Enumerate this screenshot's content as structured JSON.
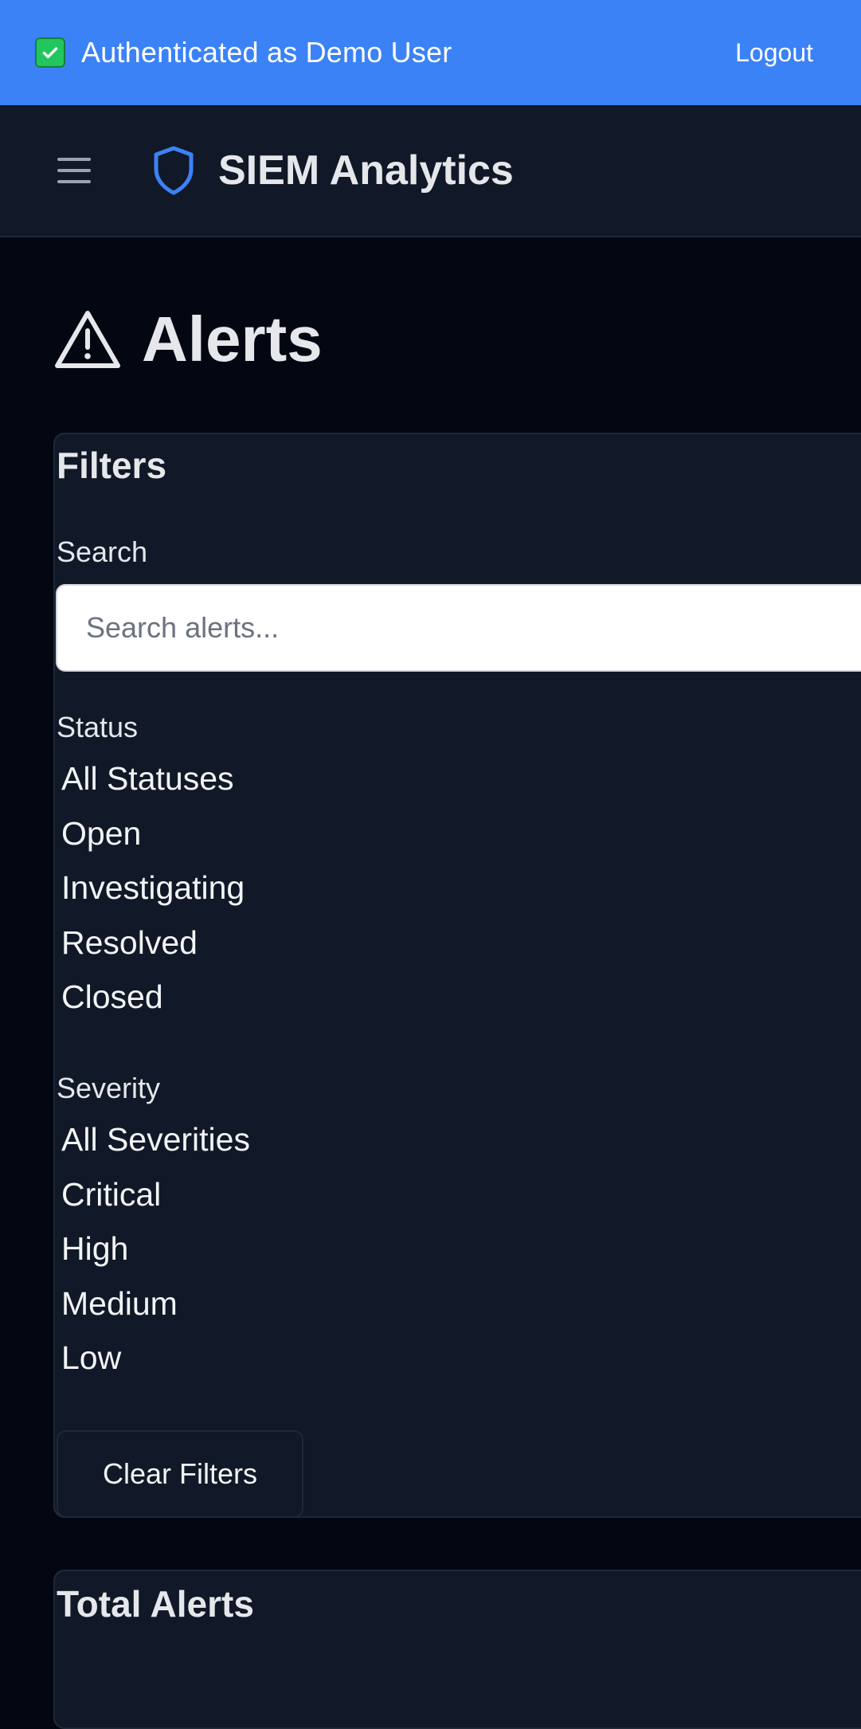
{
  "auth_banner": {
    "icon": "check-box-icon",
    "text": "Authenticated as Demo User",
    "logout_label": "Logout",
    "background": "#3b82f6"
  },
  "header": {
    "menu_icon": "hamburger-menu-icon",
    "brand_icon": "shield-icon",
    "brand_title": "SIEM Analytics"
  },
  "page": {
    "title_icon": "warning-triangle-icon",
    "title": "Alerts"
  },
  "filters": {
    "heading": "Filters",
    "search": {
      "label": "Search",
      "placeholder": "Search alerts...",
      "value": ""
    },
    "status": {
      "label": "Status",
      "options": [
        "All Statuses",
        "Open",
        "Investigating",
        "Resolved",
        "Closed"
      ]
    },
    "severity": {
      "label": "Severity",
      "options": [
        "All Severities",
        "Critical",
        "High",
        "Medium",
        "Low"
      ]
    },
    "clear_label": "Clear Filters"
  },
  "stats": {
    "title": "Total Alerts"
  },
  "colors": {
    "accent": "#3b82f6",
    "background": "#030712",
    "panel": "#111827",
    "border": "#1f2937"
  }
}
